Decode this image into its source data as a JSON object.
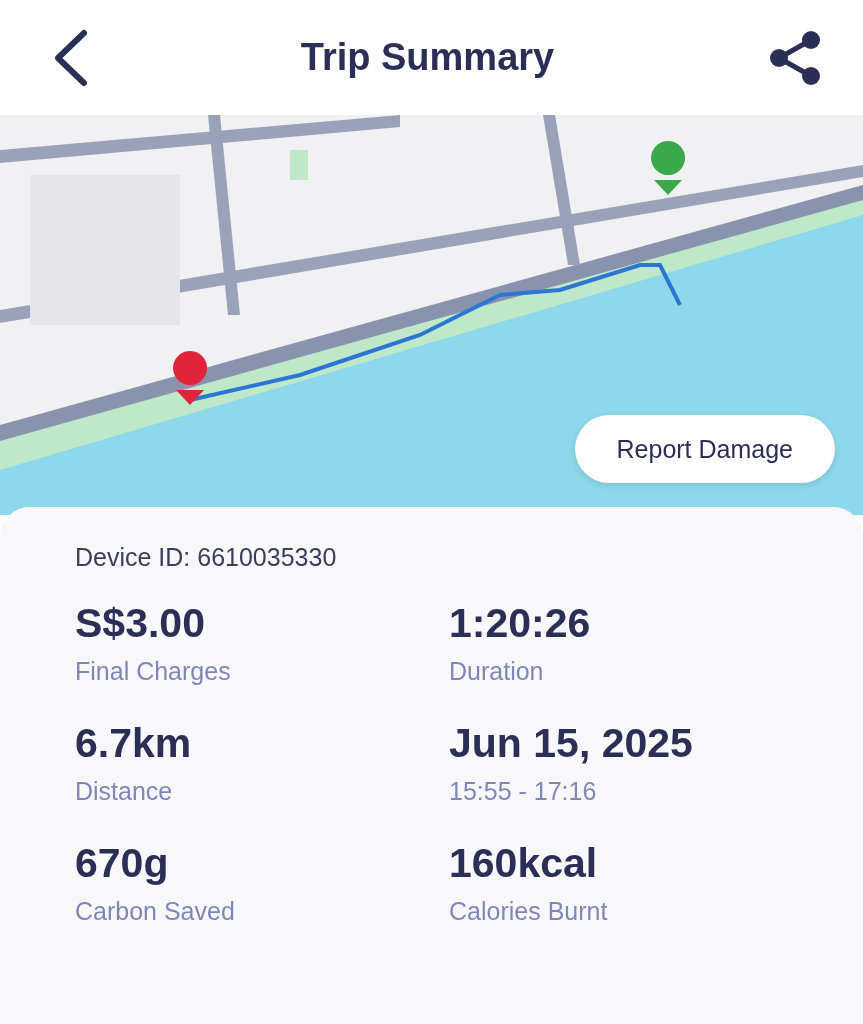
{
  "header": {
    "title": "Trip Summary"
  },
  "map": {
    "kind": "picture",
    "report_button": "Report Damage"
  },
  "summary": {
    "device_id": "Device ID: 6610035330",
    "stats": [
      {
        "value": "S$3.00",
        "label": "Final Charges"
      },
      {
        "value": "1:20:26",
        "label": "Duration"
      },
      {
        "value": "6.7km",
        "label": "Distance"
      },
      {
        "value": "Jun 15, 2025",
        "label": "15:55 - 17:16"
      },
      {
        "value": "670g",
        "label": "Carbon Saved"
      },
      {
        "value": "160kcal",
        "label": "Calories Burnt"
      }
    ]
  }
}
